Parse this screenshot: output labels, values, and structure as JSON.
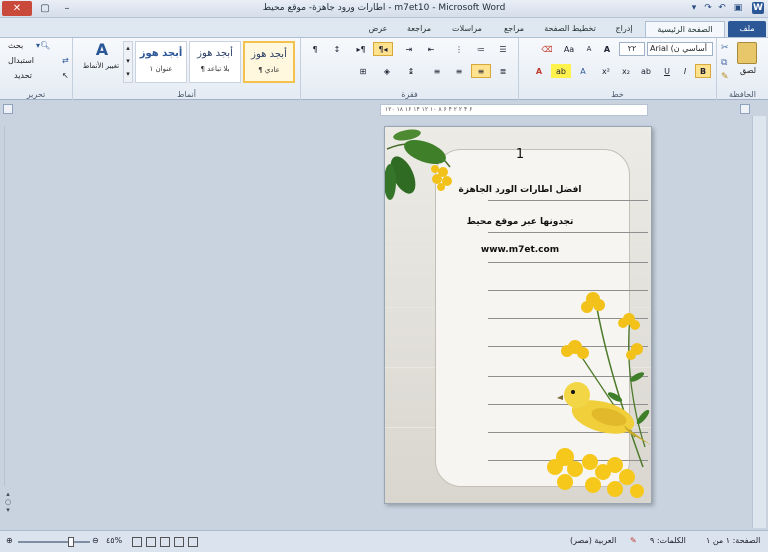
{
  "window": {
    "title": "اطارات ورود جاهزة- موقع محيط - m7et10 - Microsoft Word",
    "minimize": "–",
    "maximize": "▢",
    "close": "✕"
  },
  "tabs": [
    {
      "label": "ملف"
    },
    {
      "label": "الصفحة الرئيسية"
    },
    {
      "label": "إدراج"
    },
    {
      "label": "تخطيط الصفحة"
    },
    {
      "label": "مراجع"
    },
    {
      "label": "مراسلات"
    },
    {
      "label": "مراجعة"
    },
    {
      "label": "عرض"
    }
  ],
  "ribbon": {
    "clipboard": {
      "label": "الحافظة",
      "paste": "لصق"
    },
    "font": {
      "label": "خط",
      "font_name": "Arial (أساسي ن",
      "font_size": "٢٢",
      "bold": "B",
      "italic": "I",
      "underline": "U",
      "grow": "A",
      "shrink": "A",
      "case": "Aa"
    },
    "paragraph": {
      "label": "فقرة"
    },
    "styles": {
      "label": "أنماط",
      "items": [
        {
          "sample": "أبجد هوز",
          "name": "¶ عادي"
        },
        {
          "sample": "أبجد هوز",
          "name": "¶ بلا تباعد"
        },
        {
          "sample": "أبجد هوز",
          "name": "عنوان ١"
        }
      ],
      "change": "تغيير الأنماط"
    },
    "editing": {
      "label": "تحرير",
      "find": "بحث",
      "replace": "استبدال",
      "select": "تحديد"
    }
  },
  "ruler": {
    "ticks": "۱۲۰ ۱۸ ۱۶ ۱۴ ۱۲ ۱۰ ۸ ۶ ۴ ۲ ۲ ۴ ۶"
  },
  "document": {
    "page_number": "1",
    "line1": "افضل اطارات الورد الجاهزة",
    "line2": "تجدونها عبر موقع محيط",
    "line3": "www.m7et.com"
  },
  "status": {
    "page": "الصفحة: ١ من ١",
    "words": "الكلمات: ٩",
    "language": "العربية (مصر)",
    "zoom": "٤٥%"
  },
  "colors": {
    "accent": "#2b5797",
    "yellow_flower": "#f2c21b",
    "leaf_green": "#3f7f2a"
  }
}
